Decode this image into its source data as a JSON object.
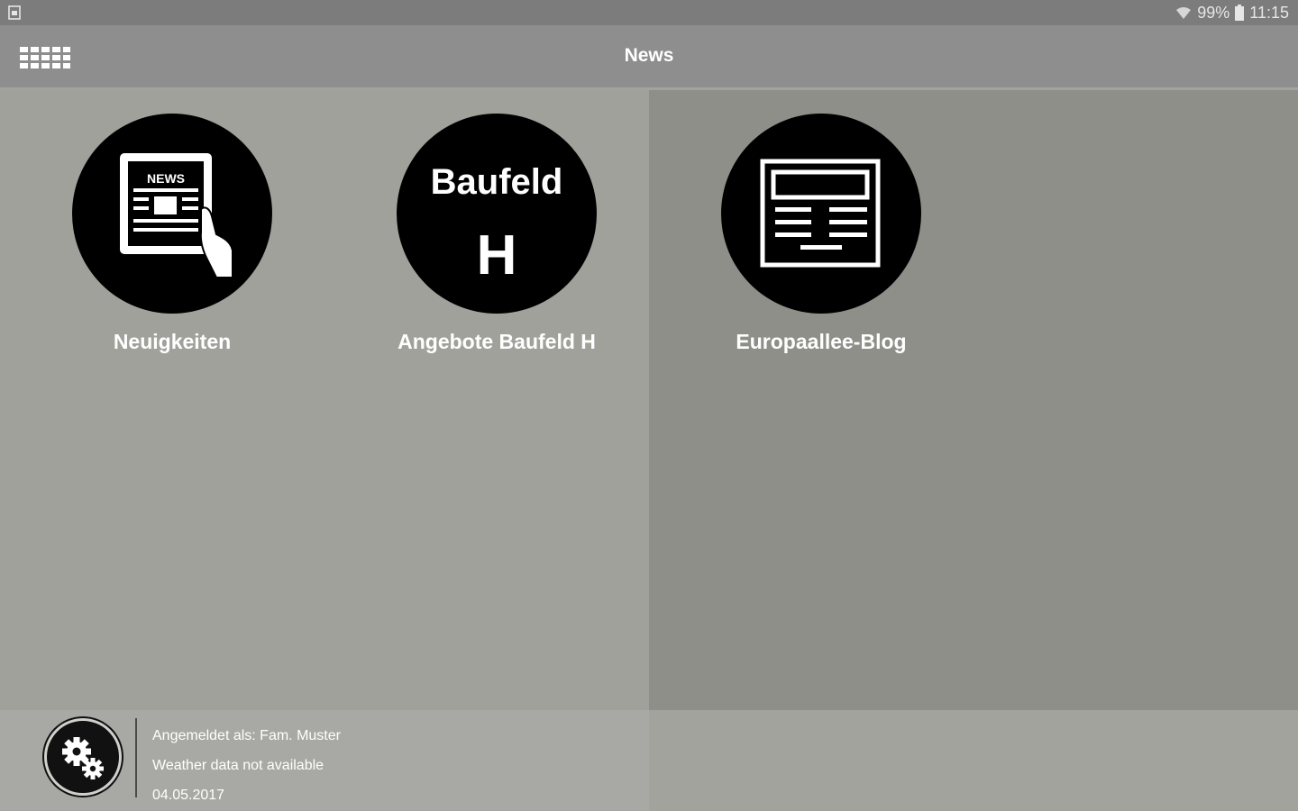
{
  "status_bar": {
    "battery": "99%",
    "time": "11:15",
    "icons": [
      "notification-icon",
      "wifi-icon",
      "battery-icon"
    ]
  },
  "app_bar": {
    "title": "News",
    "menu_icon": "grid-menu-icon"
  },
  "tiles": [
    {
      "label": "Neuigkeiten",
      "icon": "newspaper-hand-icon",
      "icon_text": "NEWS"
    },
    {
      "label": "Angebote Baufeld H",
      "icon_line1": "Baufeld",
      "icon_line2": "H"
    },
    {
      "label": "Europaallee-Blog",
      "icon": "article-icon"
    }
  ],
  "footer": {
    "logged_in": "Angemeldet als: Fam. Muster",
    "weather": "Weather data not available",
    "date": "04.05.2017",
    "settings_icon": "gears-icon"
  },
  "colors": {
    "status_bar": "#7c7c7c",
    "app_bar": "#8e8e8e",
    "content_left": "#a1a19c",
    "content_right": "#8f8f8a",
    "tile_circle": "#000000",
    "text": "#ffffff"
  }
}
